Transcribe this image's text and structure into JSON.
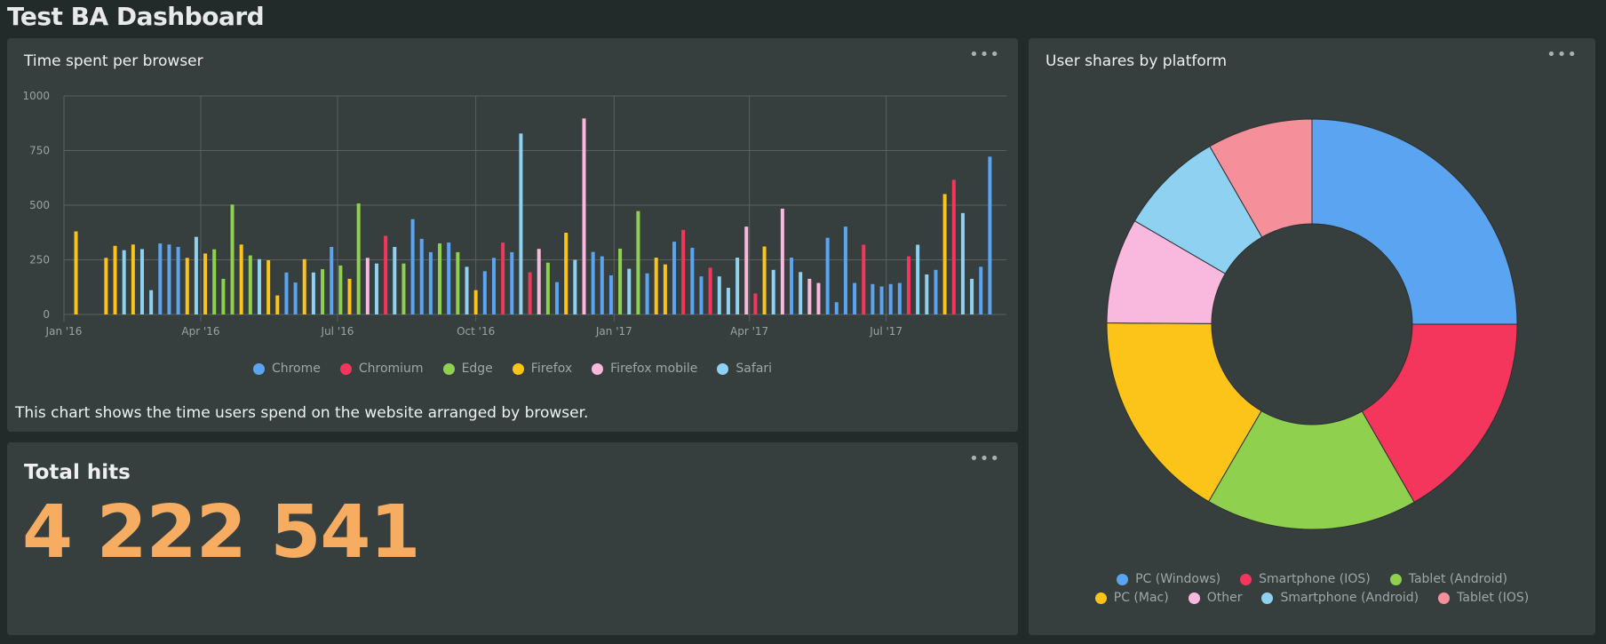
{
  "header": {
    "title": "Test BA Dashboard"
  },
  "more_label": "•••",
  "time_panel": {
    "title": "Time spent per browser",
    "description": "This chart shows the time users spend on the website arranged by browser."
  },
  "hits_panel": {
    "title": "Total hits",
    "value": "4 222 541",
    "color": "#f6ad62"
  },
  "platform_panel": {
    "title": "User shares by platform"
  },
  "chart_data": [
    {
      "type": "bar",
      "title": "Time spent per browser",
      "xlabel": "",
      "ylabel": "",
      "ylim": [
        0,
        1000
      ],
      "yticks": [
        "0",
        "250",
        "500",
        "750",
        "1000"
      ],
      "ytick_values": [
        0,
        250,
        500,
        750,
        1000
      ],
      "xlim": [
        "2016-01-01",
        "2017-09-19"
      ],
      "xticks": [
        "Jan '16",
        "Apr '16",
        "Jul '16",
        "Oct '16",
        "Jan '17",
        "Apr '17",
        "Jul '17"
      ],
      "xtick_dates": [
        "2016-01-01",
        "2016-04-01",
        "2016-07-01",
        "2016-10-01",
        "2017-01-01",
        "2017-04-01",
        "2017-07-01"
      ],
      "grid": true,
      "legend_position": "bottom",
      "legend": [
        "Chrome",
        "Chromium",
        "Edge",
        "Firefox",
        "Firefox mobile",
        "Safari"
      ],
      "colors": {
        "Chrome": "#5ba4f2",
        "Chromium": "#f5365c",
        "Edge": "#8fd14f",
        "Firefox": "#fcc419",
        "Firefox mobile": "#f9b8dd",
        "Safari": "#8ed1f0"
      },
      "x": [
        "2016-01-09",
        "2016-01-29",
        "2016-02-04",
        "2016-02-10",
        "2016-02-16",
        "2016-02-22",
        "2016-02-28",
        "2016-03-05",
        "2016-03-11",
        "2016-03-17",
        "2016-03-23",
        "2016-03-29",
        "2016-04-04",
        "2016-04-10",
        "2016-04-16",
        "2016-04-22",
        "2016-04-28",
        "2016-05-04",
        "2016-05-10",
        "2016-05-16",
        "2016-05-22",
        "2016-05-28",
        "2016-06-03",
        "2016-06-09",
        "2016-06-15",
        "2016-06-21",
        "2016-06-27",
        "2016-07-03",
        "2016-07-09",
        "2016-07-15",
        "2016-07-21",
        "2016-07-27",
        "2016-08-02",
        "2016-08-08",
        "2016-08-14",
        "2016-08-20",
        "2016-08-26",
        "2016-09-01",
        "2016-09-07",
        "2016-09-13",
        "2016-09-19",
        "2016-09-25",
        "2016-10-01",
        "2016-10-07",
        "2016-10-13",
        "2016-10-19",
        "2016-10-25",
        "2016-10-31",
        "2016-11-06",
        "2016-11-12",
        "2016-11-18",
        "2016-11-24",
        "2016-11-30",
        "2016-12-06",
        "2016-12-12",
        "2016-12-18",
        "2016-12-24",
        "2016-12-30",
        "2017-01-05",
        "2017-01-11",
        "2017-01-17",
        "2017-01-23",
        "2017-01-29",
        "2017-02-04",
        "2017-02-10",
        "2017-02-16",
        "2017-02-22",
        "2017-02-28",
        "2017-03-06",
        "2017-03-12",
        "2017-03-18",
        "2017-03-24",
        "2017-03-30",
        "2017-04-05",
        "2017-04-11",
        "2017-04-17",
        "2017-04-23",
        "2017-04-29",
        "2017-05-05",
        "2017-05-11",
        "2017-05-17",
        "2017-05-23",
        "2017-05-29",
        "2017-06-04",
        "2017-06-10",
        "2017-06-16",
        "2017-06-22",
        "2017-06-28",
        "2017-07-04",
        "2017-07-10",
        "2017-07-16",
        "2017-07-22",
        "2017-07-28",
        "2017-08-03",
        "2017-08-09",
        "2017-08-15",
        "2017-08-21",
        "2017-08-27",
        "2017-09-02",
        "2017-09-08"
      ],
      "browser": [
        "Firefox",
        "Firefox",
        "Firefox",
        "Safari",
        "Firefox",
        "Safari",
        "Safari",
        "Chrome",
        "Chrome",
        "Chrome",
        "Firefox",
        "Safari",
        "Firefox",
        "Edge",
        "Edge",
        "Edge",
        "Firefox",
        "Edge",
        "Safari",
        "Firefox",
        "Firefox",
        "Chrome",
        "Chrome",
        "Firefox",
        "Safari",
        "Edge",
        "Chrome",
        "Edge",
        "Firefox",
        "Edge",
        "Firefox mobile",
        "Safari",
        "Chromium",
        "Safari",
        "Edge",
        "Chrome",
        "Chrome",
        "Chrome",
        "Edge",
        "Chrome",
        "Edge",
        "Safari",
        "Firefox",
        "Chrome",
        "Chrome",
        "Chromium",
        "Chrome",
        "Safari",
        "Chromium",
        "Firefox mobile",
        "Edge",
        "Chrome",
        "Firefox",
        "Safari",
        "Firefox mobile",
        "Chrome",
        "Chrome",
        "Chrome",
        "Edge",
        "Safari",
        "Edge",
        "Chrome",
        "Firefox",
        "Firefox",
        "Chrome",
        "Chromium",
        "Chrome",
        "Chrome",
        "Chromium",
        "Safari",
        "Safari",
        "Safari",
        "Firefox mobile",
        "Chromium",
        "Firefox",
        "Safari",
        "Firefox mobile",
        "Chrome",
        "Safari",
        "Firefox mobile",
        "Firefox mobile",
        "Chrome",
        "Chrome",
        "Chrome",
        "Chrome",
        "Chromium",
        "Chrome",
        "Chrome",
        "Chrome",
        "Chrome",
        "Chromium",
        "Safari",
        "Safari",
        "Chrome",
        "Firefox",
        "Chromium",
        "Safari",
        "Safari",
        "Chrome",
        "Chrome"
      ],
      "values": [
        380,
        259,
        314,
        294,
        320,
        299,
        111,
        325,
        320,
        309,
        259,
        355,
        279,
        298,
        163,
        503,
        320,
        270,
        253,
        248,
        87,
        192,
        146,
        253,
        192,
        207,
        309,
        224,
        163,
        508,
        259,
        233,
        360,
        309,
        233,
        436,
        346,
        285,
        325,
        329,
        285,
        218,
        111,
        198,
        259,
        329,
        285,
        828,
        193,
        300,
        237,
        148,
        374,
        250,
        897,
        286,
        266,
        179,
        301,
        209,
        473,
        188,
        260,
        229,
        333,
        387,
        305,
        174,
        214,
        174,
        122,
        260,
        402,
        96,
        311,
        204,
        484,
        260,
        194,
        163,
        144,
        351,
        56,
        402,
        144,
        319,
        139,
        128,
        139,
        144,
        266,
        319,
        183,
        204,
        551,
        616,
        464,
        163,
        218,
        722
      ]
    },
    {
      "type": "pie",
      "title": "User shares by platform",
      "donut": true,
      "legend_position": "bottom",
      "labels": [
        "PC (Windows)",
        "Smartphone (IOS)",
        "Tablet (Android)",
        "PC (Mac)",
        "Other",
        "Smartphone (Android)",
        "Tablet (IOS)"
      ],
      "values": [
        25,
        16.7,
        16.7,
        16.7,
        8.3,
        8.3,
        8.3
      ],
      "colors": [
        "#5ba4f2",
        "#f5365c",
        "#8fd14f",
        "#fcc419",
        "#f9b8dd",
        "#8ed1f0",
        "#f58f9a"
      ]
    }
  ]
}
